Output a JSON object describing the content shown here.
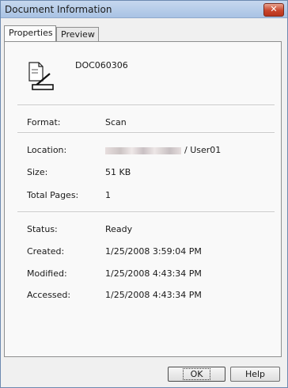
{
  "window": {
    "title": "Document Information",
    "close_label": "✕"
  },
  "tabs": [
    {
      "label": "Properties"
    },
    {
      "label": "Preview"
    }
  ],
  "document": {
    "name": "DOC060306",
    "icon": "scan-document-icon"
  },
  "fields": {
    "format": {
      "label": "Format:",
      "value": "Scan"
    },
    "location": {
      "label": "Location:",
      "value": "/ User01"
    },
    "size": {
      "label": "Size:",
      "value": "51 KB"
    },
    "total_pages": {
      "label": "Total Pages:",
      "value": "1"
    },
    "status": {
      "label": "Status:",
      "value": "Ready"
    },
    "created": {
      "label": "Created:",
      "value": "1/25/2008 3:59:04 PM"
    },
    "modified": {
      "label": "Modified:",
      "value": "1/25/2008 4:43:34 PM"
    },
    "accessed": {
      "label": "Accessed:",
      "value": "1/25/2008 4:43:34 PM"
    }
  },
  "buttons": {
    "ok_label": "OK",
    "help_label": "Help"
  }
}
